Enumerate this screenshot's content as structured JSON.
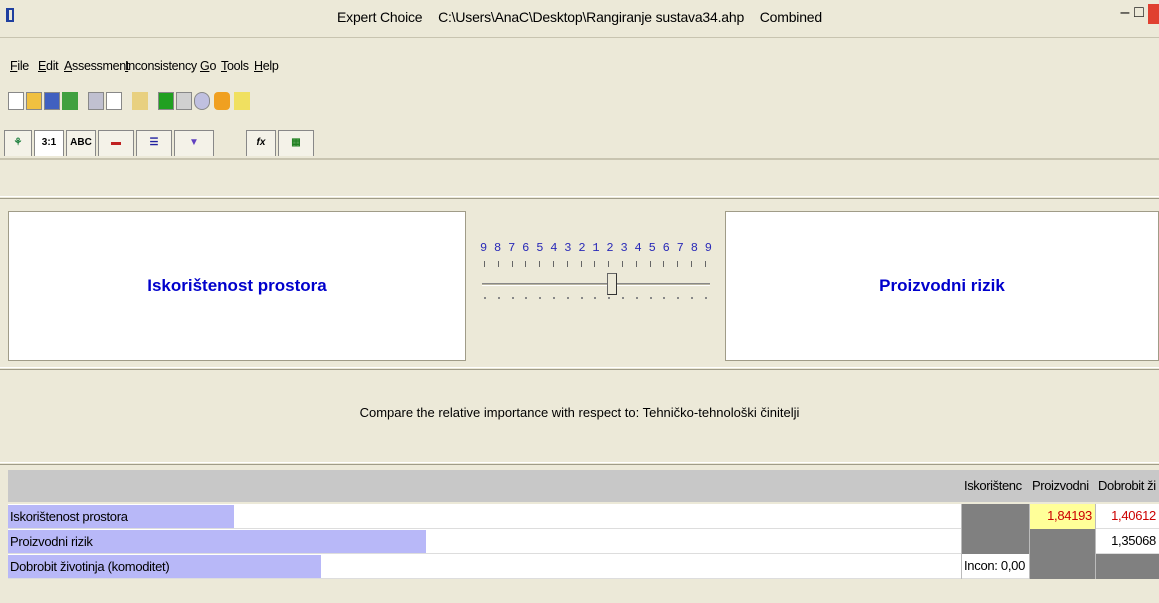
{
  "window": {
    "app_name": "Expert Choice",
    "file_path": "C:\\Users\\AnaC\\Desktop\\Rangiranje sustava34.ahp",
    "mode": "Combined",
    "minimize_label": "–",
    "maximize_label": "□"
  },
  "menu": [
    "File",
    "Edit",
    "Assessment",
    "Inconsistency",
    "Go",
    "Tools",
    "Help"
  ],
  "toolbar_icons": [
    "new-icon",
    "open-icon",
    "save-icon",
    "check-icon",
    "print-icon",
    "print-preview-icon",
    "compute-icon",
    "sheet-icon",
    "copy-icon",
    "refresh-icon",
    "link-icon",
    "pointer-icon"
  ],
  "tabs": [
    "tree-icon",
    "3:1",
    "ABC",
    "bars-icon",
    "bars-alt-icon",
    "funnel-icon",
    "fx",
    "grid-icon"
  ],
  "comparison": {
    "left_item": "Iskorištenost prostora",
    "right_item": "Proizvodni rizik",
    "scale_numbers": [
      "9",
      "8",
      "7",
      "6",
      "5",
      "4",
      "3",
      "2",
      "1",
      "2",
      "3",
      "4",
      "5",
      "6",
      "7",
      "8",
      "9"
    ],
    "prompt": "Compare the relative importance with respect to: Tehničko-tehnološki činitelji"
  },
  "grid": {
    "columns": [
      "Iskorištenc",
      "Proizvodni",
      "Dobrobit ži"
    ],
    "rows": [
      {
        "name": "Iskorištenost prostora",
        "cells": [
          "",
          "1,84193",
          "1,40612"
        ]
      },
      {
        "name": "Proizvodni rizik",
        "cells": [
          "",
          "",
          "1,35068"
        ]
      },
      {
        "name": "Dobrobit životinja (komoditet)",
        "cells": [
          "Incon: 0,00",
          "",
          ""
        ]
      }
    ]
  }
}
